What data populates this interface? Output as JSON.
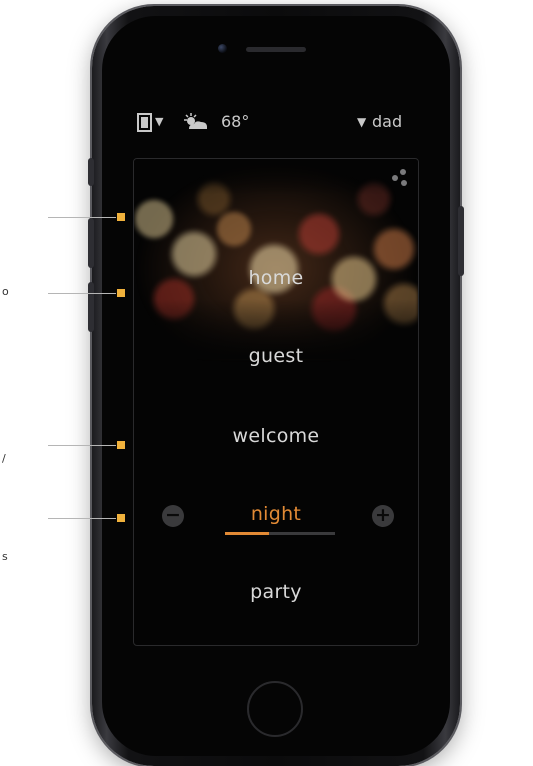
{
  "status": {
    "scene_book_icon": "book-icon",
    "weather_icon": "partly-cloudy-icon",
    "temperature": "68°",
    "user": "dad",
    "caret": "▼"
  },
  "panel": {
    "menu_icon": "dots-menu-icon",
    "scenes": [
      {
        "label": "home"
      },
      {
        "label": "guest"
      },
      {
        "label": "welcome"
      },
      {
        "label": "night",
        "active": true
      },
      {
        "label": "party"
      }
    ],
    "active_level": 0.4,
    "decrease_icon": "minus-icon",
    "increase_icon": "plus-icon"
  },
  "callouts": {
    "count": 4,
    "partial_text": [
      "o",
      "/",
      "s"
    ]
  },
  "colors": {
    "accent": "#e28a35",
    "callout_marker": "#f0b13c",
    "text": "#d9d9d9"
  }
}
